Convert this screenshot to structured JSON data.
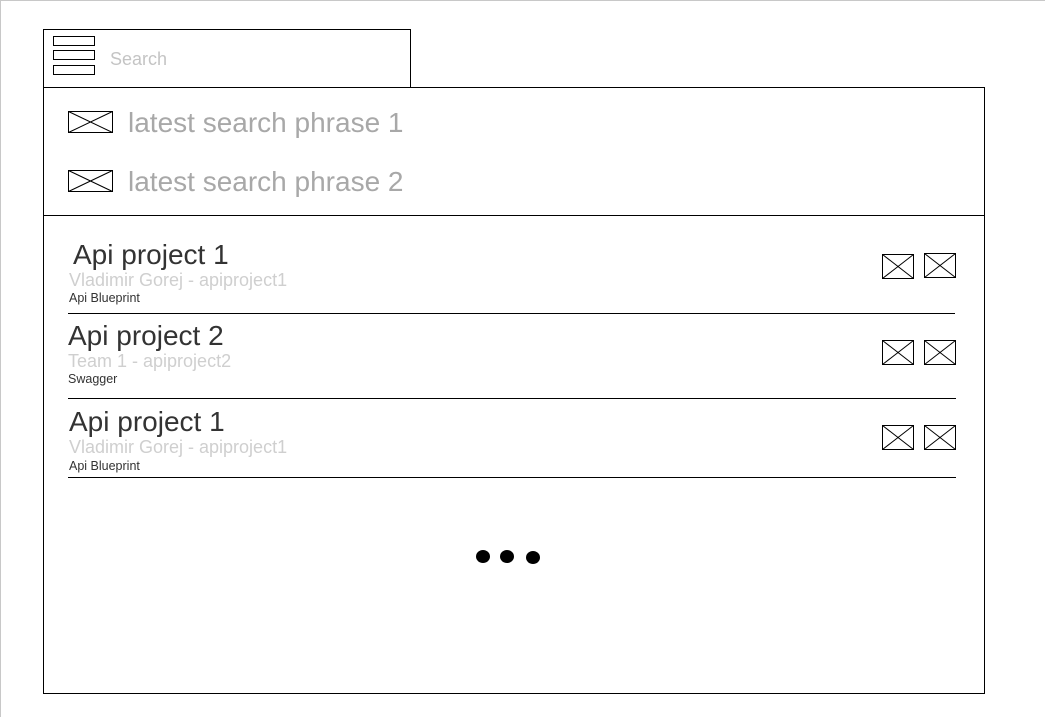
{
  "search": {
    "placeholder": "Search",
    "value": ""
  },
  "icons": {
    "menu": "hamburger-menu-icon",
    "placeholder": "image-placeholder-icon"
  },
  "recent_searches": [
    {
      "label": "latest search phrase 1"
    },
    {
      "label": "latest search phrase 2"
    }
  ],
  "projects": [
    {
      "title": "Api project 1",
      "subtitle": "Vladimir Gorej - apiproject1",
      "type": "Api Blueprint"
    },
    {
      "title": "Api project 2",
      "subtitle": "Team 1 - apiproject2",
      "type": "Swagger"
    },
    {
      "title": "Api project 1",
      "subtitle": "Vladimir Gorej - apiproject1",
      "type": "Api Blueprint"
    }
  ],
  "colors": {
    "outline": "#000000",
    "recent_text": "#a8a8a8",
    "title_text": "#333333",
    "subtitle_text": "#cfcfcf"
  }
}
